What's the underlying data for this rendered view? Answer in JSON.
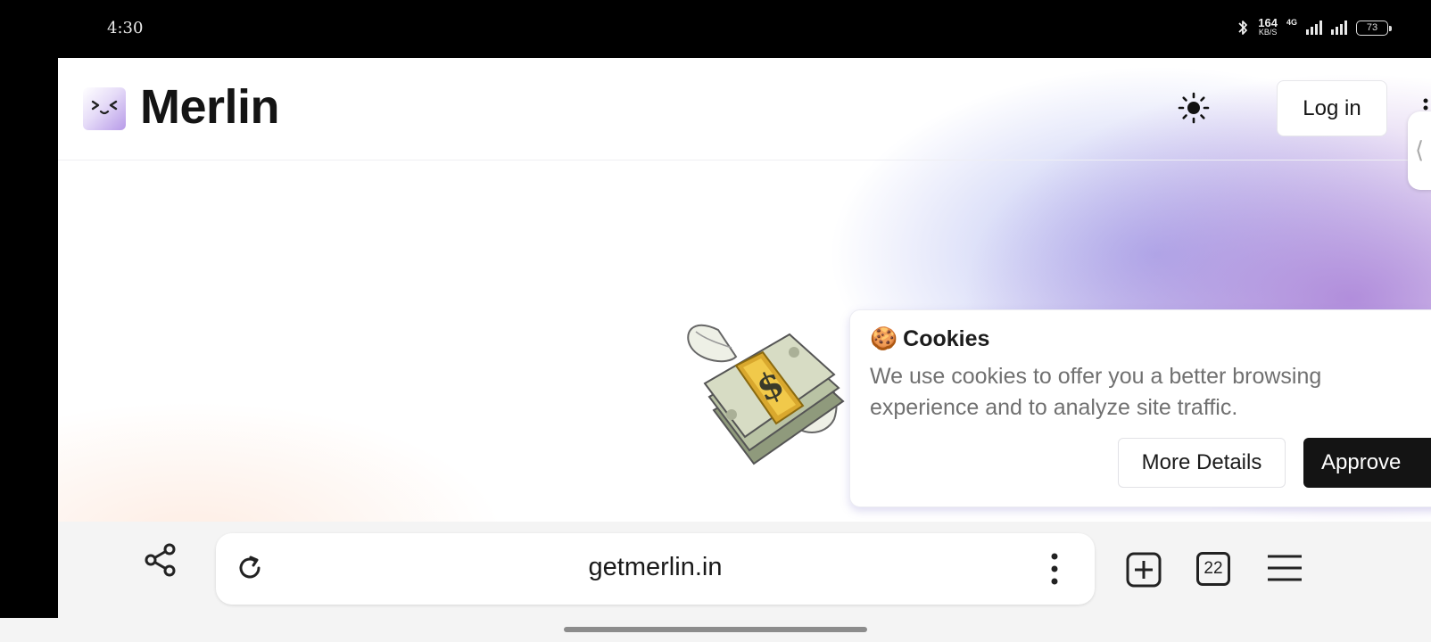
{
  "status_bar": {
    "time": "4:30",
    "net_speed": "164",
    "net_unit": "KB/S",
    "network_type": "4G",
    "battery": "73",
    "icons": [
      "bluetooth-icon",
      "signal-icon",
      "signal-icon",
      "battery-icon"
    ]
  },
  "header": {
    "brand": "Merlin",
    "login_label": "Log in",
    "icons": [
      "merlin-logo-icon",
      "sun-icon",
      "more-vertical-icon",
      "chevron-left-icon"
    ]
  },
  "hero": {
    "image": "money-with-wings-emoji"
  },
  "cookie_banner": {
    "emoji": "🍪",
    "title": "Cookies",
    "text": "We use cookies to offer you a better browsing experience and to analyze site traffic.",
    "more_details_label": "More Details",
    "approve_label": "Approve"
  },
  "toolbar": {
    "url": "getmerlin.in",
    "tab_count": "22",
    "icons": [
      "share-icon",
      "reload-icon",
      "more-vertical-icon",
      "new-tab-icon",
      "tabs-icon",
      "menu-icon"
    ]
  },
  "colors": {
    "accent_purple": "#a87ed6",
    "accent_blue": "#96a0eb",
    "approve_bg": "#141414",
    "toolbar_bg": "#f4f4f4"
  }
}
